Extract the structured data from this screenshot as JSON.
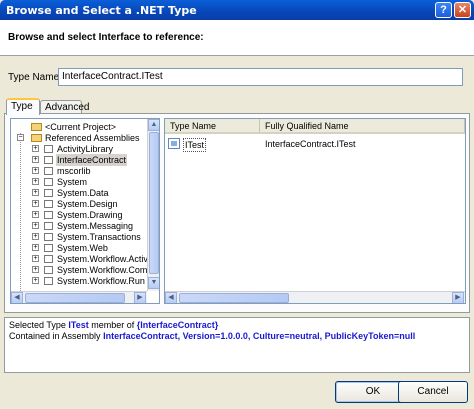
{
  "window": {
    "title": "Browse and Select a .NET Type",
    "help_glyph": "?",
    "close_glyph": "✕"
  },
  "header": {
    "text": "Browse and select Interface to reference:"
  },
  "type_name": {
    "label": "Type Name:",
    "value": "InterfaceContract.ITest"
  },
  "tabs": [
    {
      "label": "Type"
    },
    {
      "label": "Advanced"
    }
  ],
  "tree": {
    "items": [
      {
        "label": "<Current Project>"
      },
      {
        "label": "Referenced Assemblies"
      },
      {
        "label": "ActivityLibrary"
      },
      {
        "label": "InterfaceContract"
      },
      {
        "label": "mscorlib"
      },
      {
        "label": "System"
      },
      {
        "label": "System.Data"
      },
      {
        "label": "System.Design"
      },
      {
        "label": "System.Drawing"
      },
      {
        "label": "System.Messaging"
      },
      {
        "label": "System.Transactions"
      },
      {
        "label": "System.Web"
      },
      {
        "label": "System.Workflow.Activit"
      },
      {
        "label": "System.Workflow.Compo"
      },
      {
        "label": "System.Workflow.Runtim"
      }
    ]
  },
  "types_list": {
    "columns": [
      "Type Name",
      "Fully Qualified Name"
    ],
    "rows": [
      {
        "type_name": "ITest",
        "qualified": "InterfaceContract.ITest"
      }
    ]
  },
  "info": {
    "line1_prefix": "Selected Type",
    "line1_type": "ITest",
    "line1_mid": "member of",
    "line1_ns": "{InterfaceContract}",
    "line2_prefix": "Contained in Assembly",
    "line2_assembly": "InterfaceContract, Version=1.0.0.0, Culture=neutral, PublicKeyToken=null"
  },
  "buttons": {
    "ok": "OK",
    "cancel": "Cancel"
  },
  "scroll_arrows": {
    "up": "▲",
    "down": "▼",
    "left": "◀",
    "right": "▶"
  },
  "tree_glyphs": {
    "plus": "+",
    "minus": "−"
  }
}
